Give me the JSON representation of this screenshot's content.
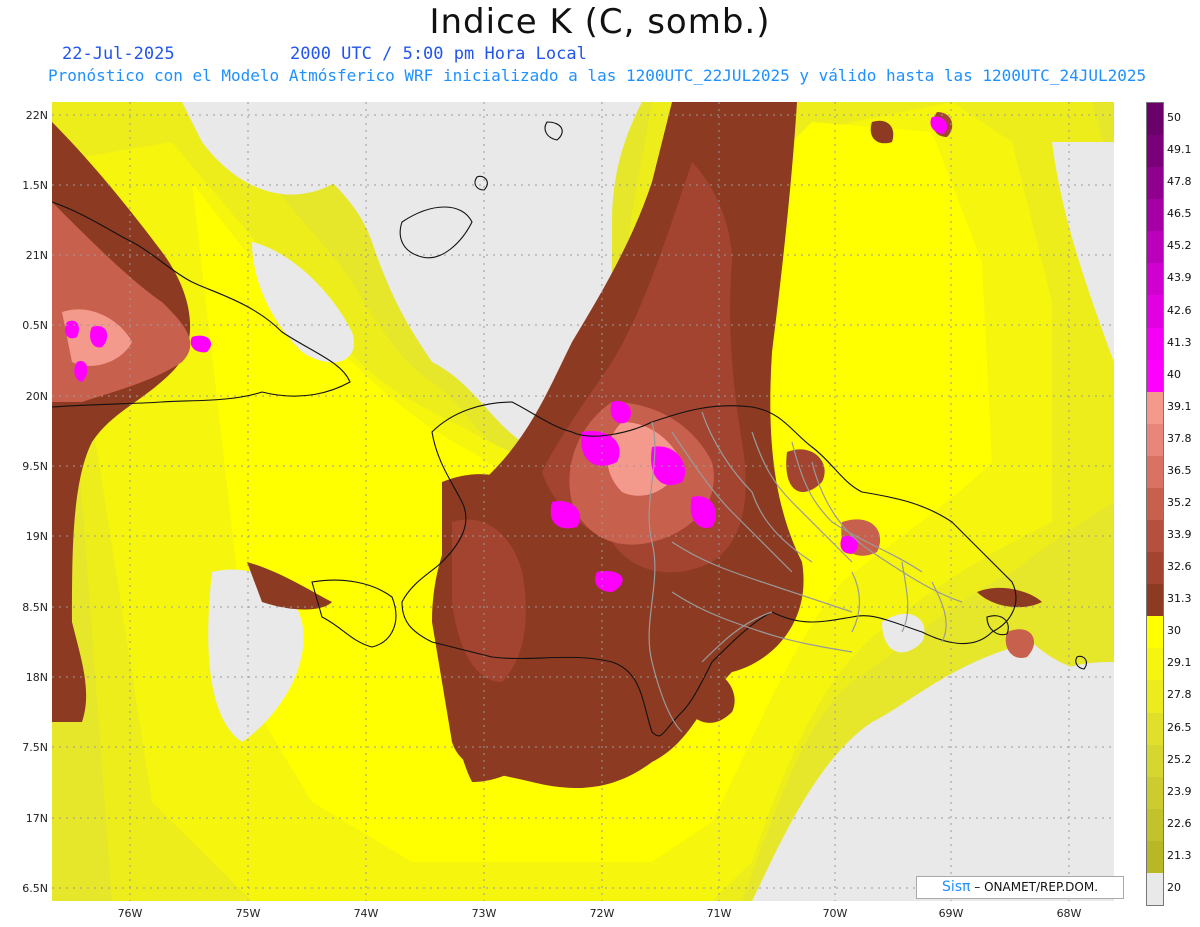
{
  "header": {
    "title": "Indice K (C, somb.)",
    "date": "22-Jul-2025",
    "time": "2000 UTC / 5:00 pm Hora Local",
    "info": "Pronóstico con el Modelo Atmósferico WRF inicializado a las 1200UTC_22JUL2025 y válido hasta las  1200UTC_24JUL2025"
  },
  "axes": {
    "lat_labels": [
      "22N",
      "1.5N",
      "21N",
      "0.5N",
      "20N",
      "9.5N",
      "19N",
      "8.5N",
      "18N",
      "7.5N",
      "17N",
      "6.5N"
    ],
    "lon_labels": [
      "76W",
      "75W",
      "74W",
      "73W",
      "72W",
      "71W",
      "70W",
      "69W",
      "68W"
    ]
  },
  "colorbar": {
    "labels": [
      "50",
      "49.1",
      "47.8",
      "46.5",
      "45.2",
      "43.9",
      "42.6",
      "41.3",
      "40",
      "39.1",
      "37.8",
      "36.5",
      "35.2",
      "33.9",
      "32.6",
      "31.3",
      "30",
      "29.1",
      "27.8",
      "26.5",
      "25.2",
      "23.9",
      "22.6",
      "21.3",
      "20"
    ],
    "colors": [
      "#6a006a",
      "#7a007a",
      "#8f008f",
      "#a500a5",
      "#bb00bb",
      "#d000d0",
      "#e200e2",
      "#f400f4",
      "#ff00ff",
      "#f49a8c",
      "#e8867a",
      "#d97262",
      "#c8604e",
      "#b5503f",
      "#a24430",
      "#8d3a22",
      "#ffff00",
      "#f5f512",
      "#ebeb20",
      "#e0e02a",
      "#d6d630",
      "#cccc30",
      "#c2c22c",
      "#b8b826",
      "#e9e9e9"
    ]
  },
  "credit": {
    "sis": "Sisπ",
    "org": "– ONAMET/REP.DOM."
  }
}
